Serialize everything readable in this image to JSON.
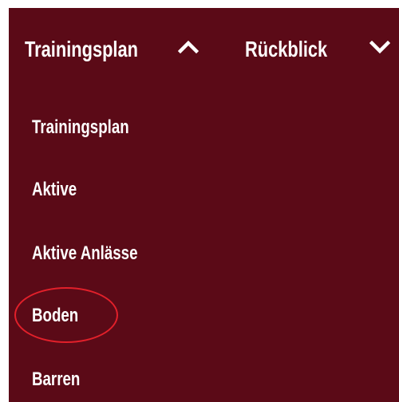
{
  "topnav": {
    "tabs": [
      {
        "label": "Trainingsplan",
        "icon": "chevron-up-icon",
        "expanded": true
      },
      {
        "label": "Rückblick",
        "icon": "chevron-down-icon",
        "expanded": false
      }
    ]
  },
  "dropdown": {
    "items": [
      {
        "label": "Trainingsplan"
      },
      {
        "label": "Aktive"
      },
      {
        "label": "Aktive Anlässe"
      },
      {
        "label": "Boden",
        "highlighted": true
      },
      {
        "label": "Barren"
      }
    ]
  },
  "colors": {
    "background": "#5b0a17",
    "text": "#ffffff",
    "highlight_circle": "#e2202a"
  }
}
